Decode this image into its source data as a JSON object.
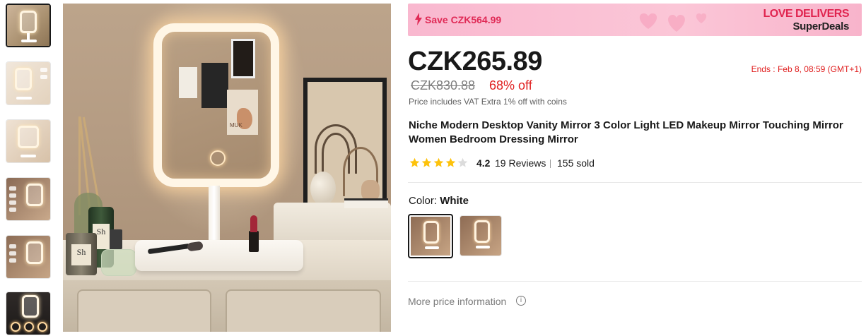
{
  "gallery": {
    "thumbnails": [
      {
        "name": "thumb-1",
        "active": true
      },
      {
        "name": "thumb-2",
        "active": false
      },
      {
        "name": "thumb-3",
        "active": false
      },
      {
        "name": "thumb-4",
        "active": false
      },
      {
        "name": "thumb-5",
        "active": false
      },
      {
        "name": "thumb-6",
        "active": false
      }
    ],
    "main_image_text": {
      "jar_label_1": "Sh",
      "jar_label_2": "Sh",
      "poster_text": "MUK"
    }
  },
  "banner": {
    "save_text": "Save CZK564.99",
    "brand_line1": "LOVE DELIVERS",
    "brand_line2": "SuperDeals",
    "accent_color": "#e0244f",
    "icon": "lightning-bolt-icon"
  },
  "pricing": {
    "current_price": "CZK265.89",
    "original_price": "CZK830.88",
    "discount": "68% off",
    "vat_note": "Price includes VAT Extra 1% off with coins",
    "ends_text": "Ends :  Feb 8, 08:59 (GMT+1)",
    "sale_color": "#e02020"
  },
  "product": {
    "title": "Niche Modern Desktop Vanity Mirror 3 Color Light LED Makeup Mirror Touching Mirror Women Bedroom Dressing Mirror",
    "rating_value": 4.2,
    "rating_text": "4.2",
    "stars_filled": 4,
    "stars_total": 5,
    "reviews": "19 Reviews",
    "sold": "155 sold"
  },
  "color": {
    "label": "Color: ",
    "selected": "White",
    "options": [
      "option-1",
      "option-2"
    ]
  },
  "more_info": {
    "label": "More price information",
    "icon": "info-icon"
  }
}
